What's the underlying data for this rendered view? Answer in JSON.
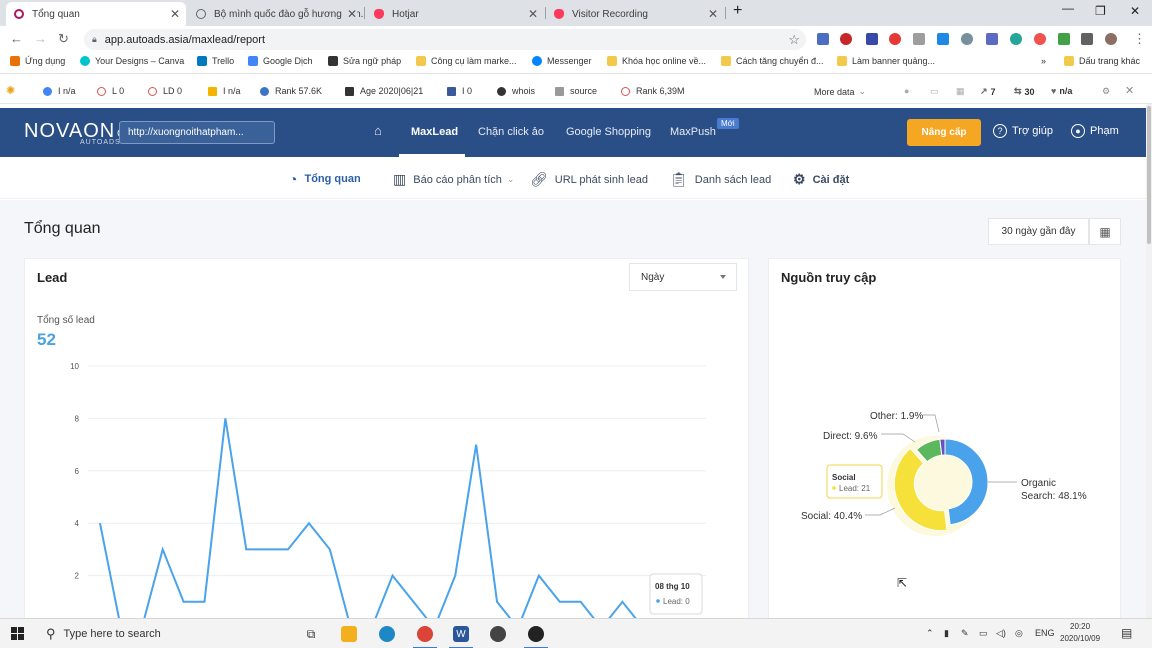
{
  "browser": {
    "tabs": [
      {
        "title": "Tổng quan",
        "icon": "novaon-favicon-icon",
        "active": true
      },
      {
        "title": "Bộ mình quốc đào gỗ hương văn...",
        "icon": "globe-favicon-icon",
        "active": false
      },
      {
        "title": "Hotjar",
        "icon": "hotjar-favicon-icon",
        "active": false
      },
      {
        "title": "Visitor Recording",
        "icon": "hotjar-favicon-icon",
        "active": false
      }
    ],
    "new_tab": "+",
    "address": "app.autoads.asia/maxlead/report",
    "bookmarks": [
      "Ứng dụng",
      "Your Designs – Canva",
      "Trello",
      "Google Dịch",
      "Sửa ngữ pháp",
      "Công cụ làm marke...",
      "Messenger",
      "Khóa học online về...",
      "Cách tăng chuyển đ...",
      "Làm banner quảng...",
      "»",
      "Dấu trang khác"
    ]
  },
  "seo_toolbar": {
    "items": [
      "I n/a",
      "L 0",
      "LD 0",
      "I n/a",
      "Rank 57.6K",
      "Age 2020|06|21",
      "I 0",
      "whois",
      "source",
      "Rank 6,39M"
    ],
    "more": "More data",
    "counts": [
      "7",
      "30",
      "n/a"
    ]
  },
  "app_header": {
    "logo": "NOVAON",
    "logo_sub": "AUTOADS",
    "site_url": "http://xuongnoithatpham...",
    "nav": [
      "MaxLead",
      "Chặn click ảo",
      "Google Shopping",
      "MaxPush"
    ],
    "new_badge": "Mới",
    "upgrade": "Nâng cấp",
    "help": "Trợ giúp",
    "user": "Phạm"
  },
  "subnav": {
    "items": [
      "Tổng quan",
      "Báo cáo phân tích",
      "URL phát sinh lead",
      "Danh sách lead",
      "Cài đặt"
    ]
  },
  "page": {
    "title": "Tổng quan",
    "date_range": "30 ngày gần đây"
  },
  "lead_card": {
    "title": "Lead",
    "period_select": "Ngày",
    "total_label": "Tổng số lead",
    "total_value": "52",
    "tooltip": {
      "date": "08 thg 10",
      "text": "Lead: 0"
    }
  },
  "source_card": {
    "title": "Nguồn truy cập",
    "tooltip": {
      "name": "Social",
      "text": "Lead: 21"
    }
  },
  "chart_data": [
    {
      "type": "line",
      "title": "Lead",
      "y_ticks": [
        2,
        4,
        6,
        8,
        10
      ],
      "ylim": [
        0,
        10
      ],
      "grid": true,
      "series": [
        {
          "name": "Lead",
          "color": "#4aa3ea",
          "values": [
            4,
            0,
            0,
            3,
            1,
            1,
            8,
            3,
            3,
            3,
            4,
            3,
            0,
            0,
            2,
            1,
            0,
            2,
            7,
            1,
            0,
            2,
            1,
            1,
            0,
            1,
            0,
            0,
            0,
            0
          ]
        }
      ]
    },
    {
      "type": "pie",
      "title": "Nguồn truy cập",
      "slices": [
        {
          "label": "Organic Search",
          "value": 48.1,
          "color": "#4aa3ea"
        },
        {
          "label": "Social",
          "value": 40.4,
          "color": "#f6e13a"
        },
        {
          "label": "Direct",
          "value": 9.6,
          "color": "#5cb85c"
        },
        {
          "label": "Other",
          "value": 1.9,
          "color": "#6a4fc1"
        }
      ],
      "labels": [
        "Other: 1.9%",
        "Direct: 9.6%",
        "Social: 40.4%",
        "Organic",
        "Search: 48.1%"
      ]
    }
  ],
  "taskbar": {
    "search_placeholder": "Type here to search",
    "lang": "ENG",
    "time": "20:20",
    "date": "2020/10/09"
  }
}
